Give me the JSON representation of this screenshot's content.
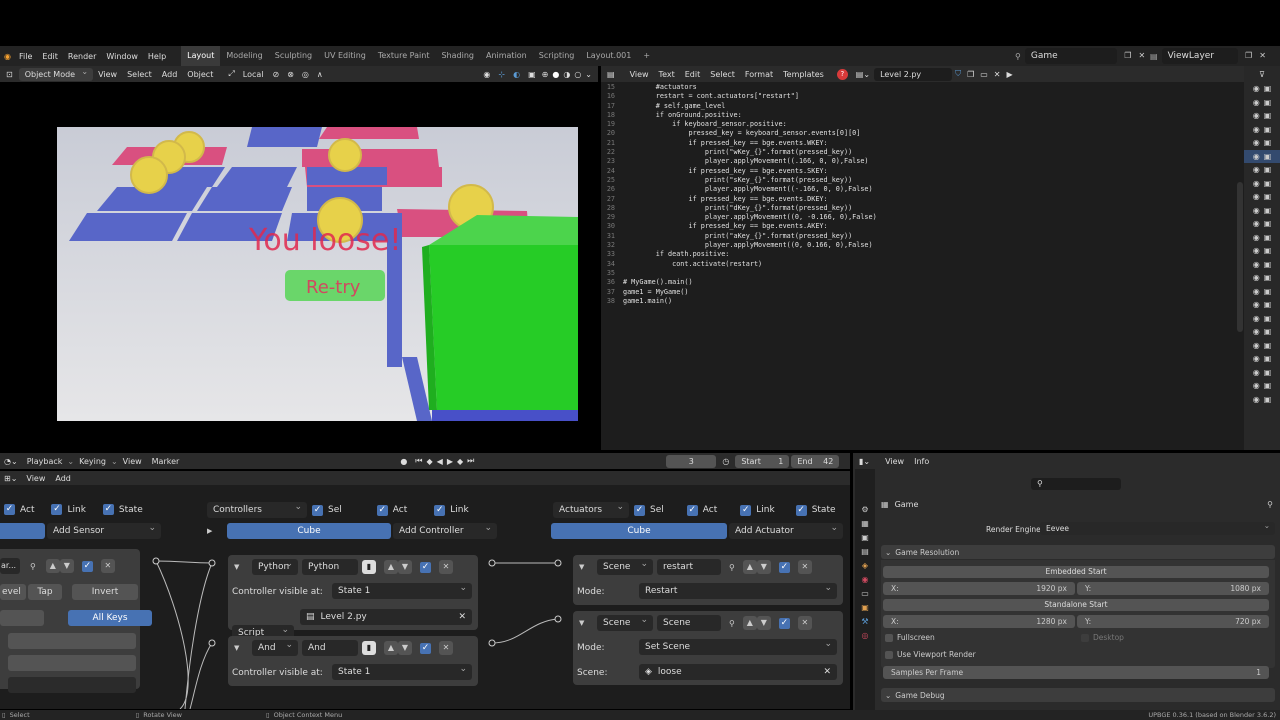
{
  "menu": {
    "items": [
      "File",
      "Edit",
      "Render",
      "Window",
      "Help"
    ]
  },
  "workspaces": {
    "tabs": [
      "Layout",
      "Modeling",
      "Sculpting",
      "UV Editing",
      "Texture Paint",
      "Shading",
      "Animation",
      "Scripting",
      "Layout.001"
    ],
    "active": "Layout",
    "add": "+"
  },
  "scene": {
    "name": "Game",
    "viewlayer": "ViewLayer"
  },
  "viewport": {
    "mode": "Object Mode",
    "menus": [
      "View",
      "Select",
      "Add",
      "Object"
    ],
    "orientation": "Local",
    "game": {
      "lose_text": "You loose!",
      "retry": "Re-try"
    }
  },
  "text_editor": {
    "menus": [
      "View",
      "Text",
      "Edit",
      "Select",
      "Format",
      "Templates"
    ],
    "filename": "Level 2.py",
    "lines": [
      {
        "n": "15",
        "t": "        #actuators"
      },
      {
        "n": "16",
        "t": "        restart = cont.actuators[\"restart\"]"
      },
      {
        "n": "17",
        "t": "        # self.game_level"
      },
      {
        "n": "18",
        "t": "        if onGround.positive:"
      },
      {
        "n": "19",
        "t": "            if keyboard_sensor.positive:"
      },
      {
        "n": "20",
        "t": "                pressed_key = keyboard_sensor.events[0][0]"
      },
      {
        "n": "21",
        "t": "                if pressed_key == bge.events.WKEY:"
      },
      {
        "n": "22",
        "t": "                    print(\"wKey_{}\".format(pressed_key))"
      },
      {
        "n": "23",
        "t": "                    player.applyMovement((.166, 0, 0),False)"
      },
      {
        "n": "24",
        "t": "                if pressed_key == bge.events.SKEY:"
      },
      {
        "n": "25",
        "t": "                    print(\"sKey_{}\".format(pressed_key))"
      },
      {
        "n": "26",
        "t": "                    player.applyMovement((-.166, 0, 0),False)"
      },
      {
        "n": "27",
        "t": "                if pressed_key == bge.events.DKEY:"
      },
      {
        "n": "28",
        "t": "                    print(\"dKey_{}\".format(pressed_key))"
      },
      {
        "n": "29",
        "t": "                    player.applyMovement((0, -0.166, 0),False)"
      },
      {
        "n": "30",
        "t": "                if pressed_key == bge.events.AKEY:"
      },
      {
        "n": "31",
        "t": "                    print(\"aKey_{}\".format(pressed_key))"
      },
      {
        "n": "32",
        "t": "                    player.applyMovement((0, 0.166, 0),False)"
      },
      {
        "n": "33",
        "t": "        if death.positive:"
      },
      {
        "n": "34",
        "t": "            cont.activate(restart)"
      },
      {
        "n": "35",
        "t": ""
      },
      {
        "n": "36",
        "t": "# MyGame().main()"
      },
      {
        "n": "37",
        "t": "game1 = MyGame()"
      },
      {
        "n": "38",
        "t": "game1.main()"
      }
    ]
  },
  "timeline": {
    "menus": [
      "Playback",
      "Keying",
      "View",
      "Marker"
    ],
    "frame": "3",
    "start_label": "Start",
    "start": "1",
    "end_label": "End",
    "end": "42"
  },
  "logic": {
    "menus": [
      "View",
      "Add"
    ],
    "sensors": {
      "act": "Act",
      "link": "Link",
      "state": "State",
      "add": "Add Sensor",
      "s_field": "ar...",
      "level": "evel",
      "tap": "Tap",
      "invert": "Invert",
      "allkeys": "All Keys"
    },
    "controllers": {
      "title": "Controllers",
      "sel": "Sel",
      "act": "Act",
      "link": "Link",
      "object": "Cube",
      "add": "Add Controller",
      "python": {
        "type": "Python",
        "name": "Python",
        "vis_label": "Controller visible at:",
        "state": "State 1",
        "mode": "Script",
        "script": "Level 2.py"
      },
      "and": {
        "type": "And",
        "name": "And",
        "vis_label": "Controller visible at:",
        "state": "State 1"
      }
    },
    "actuators": {
      "title": "Actuators",
      "sel": "Sel",
      "act": "Act",
      "link": "Link",
      "state": "State",
      "object": "Cube",
      "add": "Add Actuator",
      "a1": {
        "type": "Scene",
        "name": "restart",
        "mode_label": "Mode:",
        "mode": "Restart"
      },
      "a2": {
        "type": "Scene",
        "name": "Scene",
        "mode_label": "Mode:",
        "mode": "Set Scene",
        "scene_label": "Scene:",
        "scene": "loose"
      }
    }
  },
  "properties": {
    "menus": [
      "View",
      "Info"
    ],
    "context": "Game",
    "render_engine_label": "Render Engine",
    "render_engine": "Eevee",
    "resolution": {
      "title": "Game Resolution",
      "embedded": "Embedded Start",
      "ex": "1920 px",
      "ey": "1080 px",
      "standalone": "Standalone Start",
      "sx": "1280 px",
      "sy": "720 px",
      "x": "X:",
      "y": "Y:"
    },
    "fullscreen": "Fullscreen",
    "desktop": "Desktop",
    "viewport_render": "Use Viewport Render",
    "samples_label": "Samples Per Frame",
    "samples": "1",
    "debug": "Game Debug"
  },
  "status": {
    "select": "Select",
    "rotate": "Rotate View",
    "context": "Object Context Menu",
    "version": "UPBGE 0.36.1 (based on Blender 3.6.2)"
  }
}
